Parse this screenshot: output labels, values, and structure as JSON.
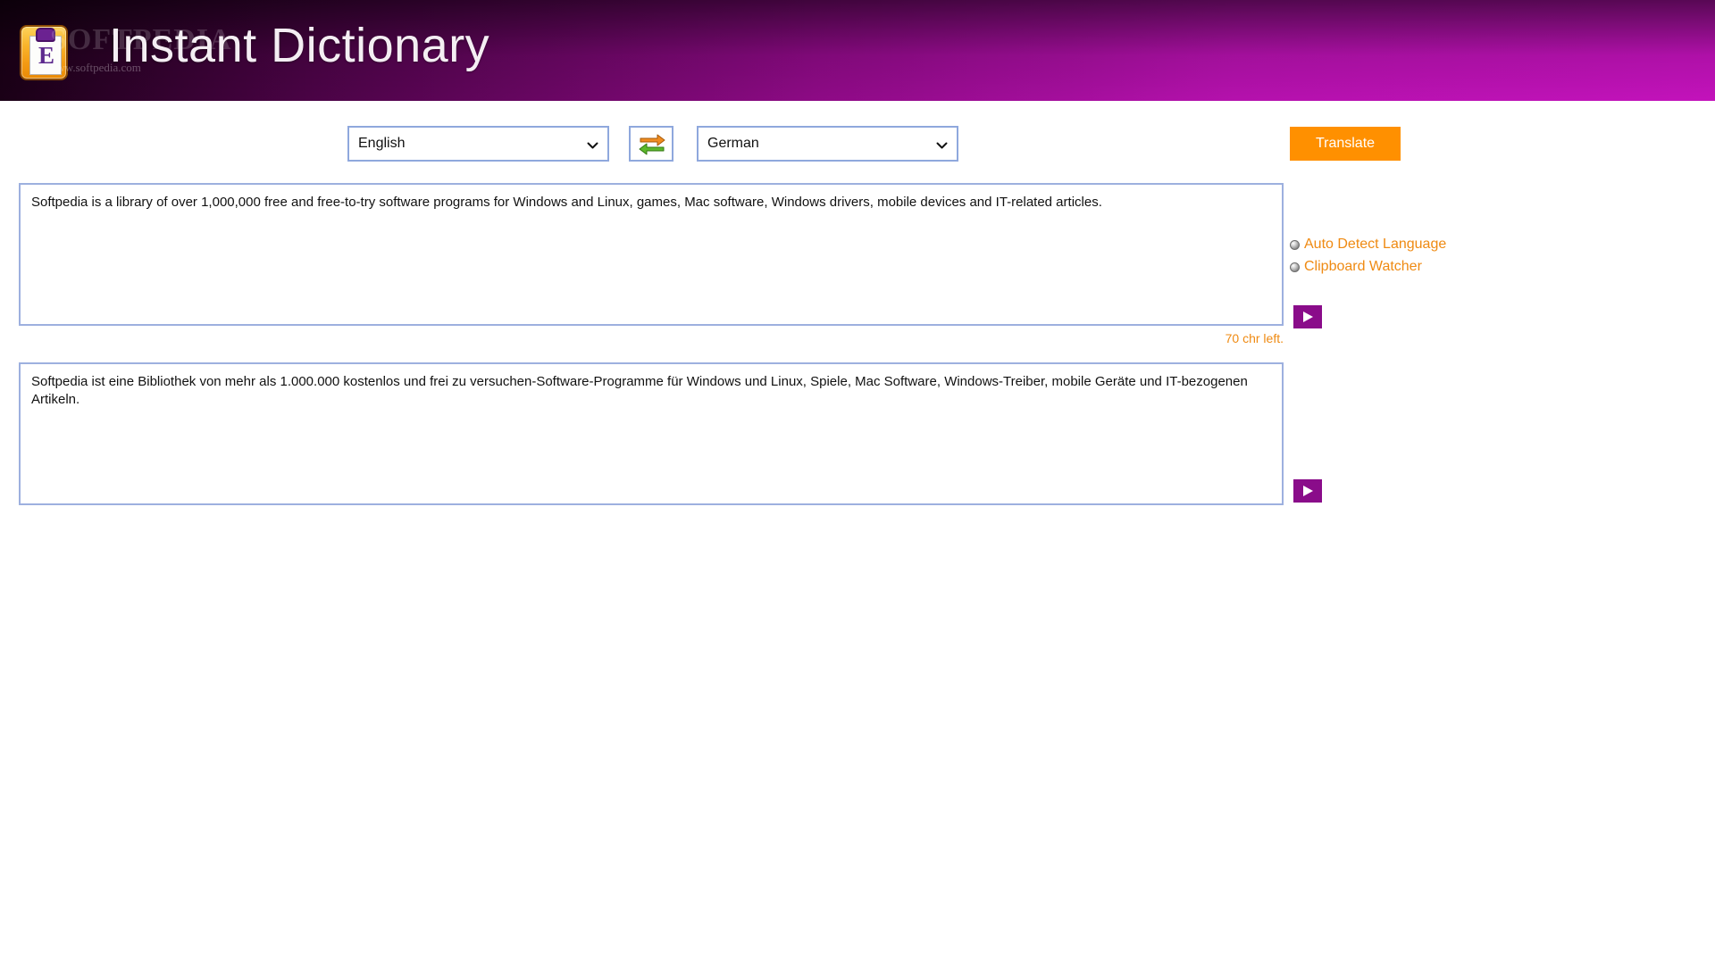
{
  "header": {
    "app_title": "Instant Dictionary",
    "logo_icon": "clipboard-icon",
    "logo_glyph": "E",
    "watermark_text": "SOFTPEDIA",
    "watermark_url": "www.softpedia.com",
    "gradient_from": "#1a0016",
    "gradient_to": "#c312bb"
  },
  "toolbar": {
    "source_language": "English",
    "target_language": "German",
    "swap_icon": "swap-languages-icon",
    "swap_arrow_top_color": "#f08c21",
    "swap_arrow_bottom_color": "#5cb82a",
    "translate_label": "Translate",
    "translate_color": "#ff9000",
    "chevron_icon": "chevron-down-icon"
  },
  "source_panel": {
    "text": "Softpedia is a library of over 1,000,000 free and free-to-try software programs for Windows and Linux, games, Mac software, Windows drivers, mobile devices and IT-related articles.",
    "placeholder": "",
    "chars_left": "70 chr left.",
    "chars_left_color": "#ef8a12",
    "speak_icon": "play-icon",
    "speak_color": "#8a0c8a"
  },
  "target_panel": {
    "text": "Softpedia ist eine Bibliothek von mehr als 1.000.000 kostenlos und frei zu versuchen-Software-Programme für Windows und Linux, Spiele, Mac Software, Windows-Treiber, mobile Geräte und IT-bezogenen Artikeln.",
    "placeholder": "",
    "speak_icon": "play-icon",
    "speak_color": "#8a0c8a"
  },
  "options": {
    "items": [
      {
        "label": "Auto Detect Language",
        "icon": "bullet-icon"
      },
      {
        "label": "Clipboard Watcher",
        "icon": "bullet-icon"
      }
    ],
    "label_color": "#ef8a12"
  }
}
